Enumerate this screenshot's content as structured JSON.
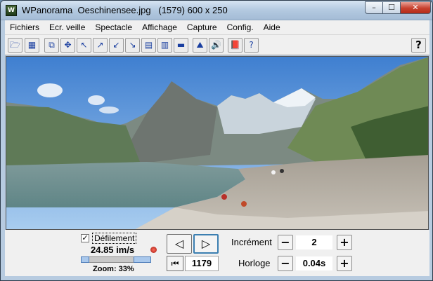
{
  "window": {
    "title": "WPanorama  Oeschinensee.jpg   (1579) 600 x 250",
    "app_icon_glyph": "W",
    "controls": {
      "minimize": "–",
      "maximize": "☐",
      "close": "✕"
    }
  },
  "menu": [
    "Fichiers",
    "Ecr. veille",
    "Spectacle",
    "Affichage",
    "Capture",
    "Config.",
    "Aide"
  ],
  "toolbar": {
    "buttons": [
      {
        "icon": "open-folder-icon",
        "glyph": "🗁"
      },
      {
        "icon": "picture-icon",
        "glyph": "▦"
      },
      {
        "icon": "fit-window-icon",
        "glyph": "⧉"
      },
      {
        "icon": "move-all-icon",
        "glyph": "✥"
      },
      {
        "icon": "arrow-upleft-icon",
        "glyph": "↖"
      },
      {
        "icon": "arrow-upright-icon",
        "glyph": "↗"
      },
      {
        "icon": "arrow-downleft-icon",
        "glyph": "↙"
      },
      {
        "icon": "arrow-downright-icon",
        "glyph": "↘"
      },
      {
        "icon": "view-full-icon",
        "glyph": "▤"
      },
      {
        "icon": "view-strip-icon",
        "glyph": "▥"
      },
      {
        "icon": "view-thin-icon",
        "glyph": "▬"
      },
      {
        "icon": "person-icon",
        "glyph": "⛰"
      },
      {
        "icon": "sound-icon",
        "glyph": "🔊"
      },
      {
        "icon": "book-icon",
        "glyph": "📕"
      },
      {
        "icon": "help-book-icon",
        "glyph": "?"
      }
    ],
    "help": "?"
  },
  "controls": {
    "scroll_label": "Défilement",
    "scroll_checked": "✓",
    "speed": "24.85 im/s",
    "zoom": "Zoom: 33%",
    "prev": "◁",
    "next": "▷",
    "first": "⏮",
    "frame": "1179",
    "increment_label": "Incrément",
    "increment_value": "2",
    "clock_label": "Horloge",
    "clock_value": "0.04s",
    "minus": "−",
    "plus": "+"
  }
}
